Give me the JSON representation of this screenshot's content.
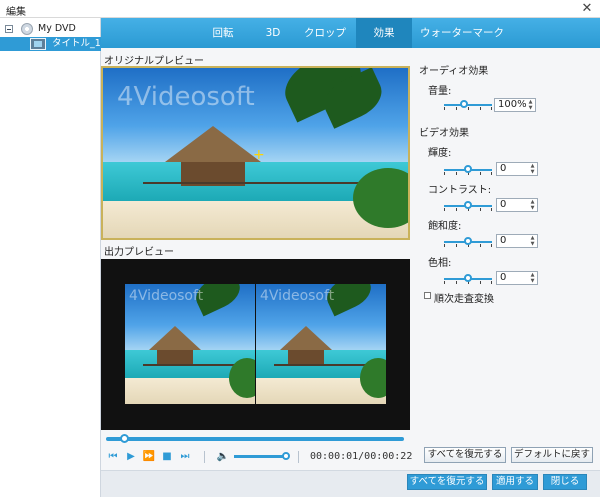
{
  "window": {
    "title": "編集",
    "close_glyph": "✕"
  },
  "tree": {
    "items": [
      {
        "label": "My DVD",
        "icon": "disc-icon"
      },
      {
        "label": "タイトル_1",
        "icon": "film-icon"
      }
    ]
  },
  "tabs": [
    {
      "label": "回転"
    },
    {
      "label": "3D"
    },
    {
      "label": "クロップ"
    },
    {
      "label": "効果",
      "active": true
    },
    {
      "label": "ウォーターマーク"
    }
  ],
  "preview": {
    "original_label": "オリジナルプレビュー",
    "output_label": "出力プレビュー",
    "watermark_text": "4Videosoft",
    "timecode": "00:00:01/00:00:22"
  },
  "playback": {
    "progress_fraction": 0.06,
    "volume_fraction": 1.0,
    "buttons": [
      "prev-icon",
      "play-icon",
      "fast-forward-icon",
      "stop-icon",
      "next-icon",
      "volume-icon"
    ]
  },
  "effects": {
    "audio_heading": "オーディオ効果",
    "volume_label": "音量:",
    "volume_value": "100%",
    "volume_level_fraction": 0.5,
    "video_heading": "ビデオ効果",
    "brightness_label": "輝度:",
    "brightness_value": "0",
    "contrast_label": "コントラスト:",
    "contrast_value": "0",
    "saturation_label": "飽和度:",
    "saturation_value": "0",
    "hue_label": "色相:",
    "hue_value": "0",
    "deinterlace_label": "順次走査変換",
    "deinterlace_checked": false,
    "reset_all_label": "すべてを復元する",
    "default_label": "デフォルトに戻す"
  },
  "footer": {
    "restore_all_label": "すべてを復元する",
    "apply_label": "適用する",
    "close_label": "閉じる"
  },
  "colors": {
    "accent": "#2f9bd6",
    "tab_active": "#1f86bd",
    "selection": "#2f9bd6"
  }
}
